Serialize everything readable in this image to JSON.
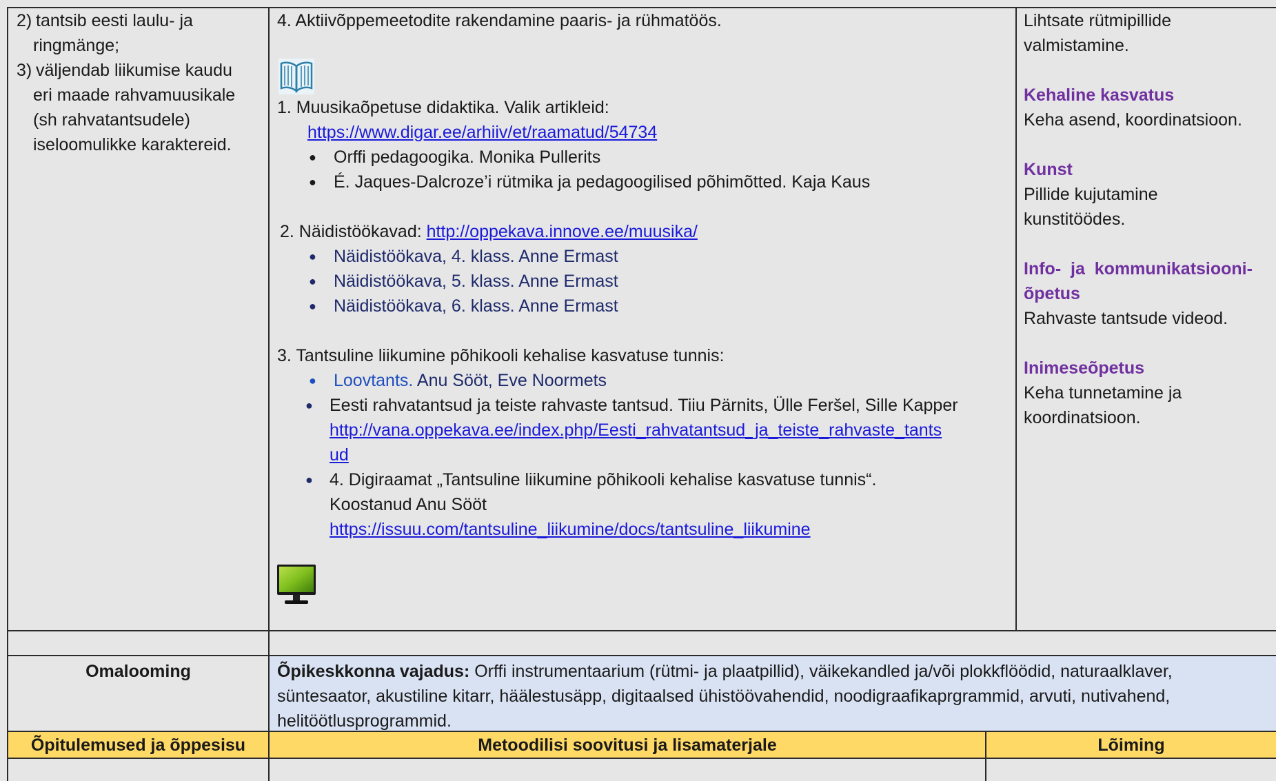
{
  "col1": {
    "items": [
      {
        "num": "2)",
        "lines": [
          "tantsib eesti laulu- ja",
          "ringmänge;"
        ]
      },
      {
        "num": "3)",
        "lines": [
          "väljendab liikumise kaudu",
          "eri maade rahvamuusikale",
          "(sh rahvatantsudele)",
          "iseloomulikke karaktereid."
        ]
      }
    ]
  },
  "col2": {
    "intro": "4. Aktiivõppemeetodite rakendamine paaris- ja rühmatöös.",
    "book_icon": "open-book-icon",
    "s1": {
      "title": "1. Muusikaõpetuse didaktika. Valik artikleid:",
      "link": "https://www.digar.ee/arhiiv/et/raamatud/54734",
      "bullets": [
        "Orffi pedagoogika. Monika Pullerits",
        "É. Jaques-Dalcroze’i rütmika ja pedagoogilised põhimõtted. Kaja Kaus"
      ]
    },
    "s2": {
      "title": "2. Näidistöökavad: ",
      "link": "http://oppekava.innove.ee/muusika/",
      "bullets": [
        "Näidistöökava, 4. klass. Anne Ermast",
        "Näidistöökava, 5. klass. Anne Ermast",
        "Näidistöökava, 6. klass. Anne Ermast"
      ]
    },
    "s3": {
      "title": "3. Tantsuline liikumine põhikooli kehalise kasvatuse tunnis:",
      "b1_link": "Loovtants.",
      "b1_rest": " Anu Sööt, Eve Noormets",
      "b2_text": "Eesti rahvatantsud ja teiste rahvaste tantsud. Tiiu Pärnits, Ülle Feršel, Sille Kapper",
      "b2_link_l1": "http://vana.oppekava.ee/index.php/Eesti_rahvatantsud_ja_teiste_rahvaste_tants",
      "b2_link_l2": "ud",
      "b3_l1": "4. Digiraamat „Tantsuline liikumine põhikooli kehalise kasvatuse tunnis“.",
      "b3_l2": "Koostanud Anu Sööt",
      "b3_link": "https://issuu.com/tantsuline_liikumine/docs/tantsuline_liikumine"
    },
    "monitor_icon": "monitor-icon"
  },
  "col3": {
    "intro": [
      "Lihtsate rütmipillide",
      "valmistamine."
    ],
    "subjects": [
      {
        "name": [
          "Kehaline kasvatus"
        ],
        "desc": [
          "Keha asend, koordinatsioon."
        ]
      },
      {
        "name": [
          "Kunst"
        ],
        "desc": [
          "Pillide kujutamine",
          "kunstitöödes."
        ]
      },
      {
        "name": [
          "Info-  ja  kommunikatsiooni-",
          "õpetus"
        ],
        "desc": [
          "Rahvaste tantsude videod."
        ]
      },
      {
        "name": [
          "Inimeseõpetus"
        ],
        "desc": [
          "Keha tunnetamine ja",
          "koordinatsioon."
        ]
      }
    ]
  },
  "omalooming": {
    "label": "Omalooming",
    "env_label": "Õpikeskkonna vajadus:",
    "env_l1": " Orffi instrumentaarium (rütmi- ja plaatpillid), väikekandled ja/või plokkflöödid, naturaalklaver,",
    "env_l2": "süntesaator, akustiline kitarr, häälestusäpp, digitaalsed ühistöövahendid, noodigraafikaprgrammid, arvuti, nutivahend,",
    "env_l3": "helitöötlusprogrammid."
  },
  "headers": {
    "h1": "Õpitulemused ja õppesisu",
    "h2": "Metoodilisi soovitusi ja lisamaterjale",
    "h3": "Lõiming"
  },
  "colors": {
    "env_bg": "#d9e2f3",
    "header_bg": "#ffd966",
    "subject_purple": "#7030a0",
    "link_blue": "#1a1adb"
  }
}
